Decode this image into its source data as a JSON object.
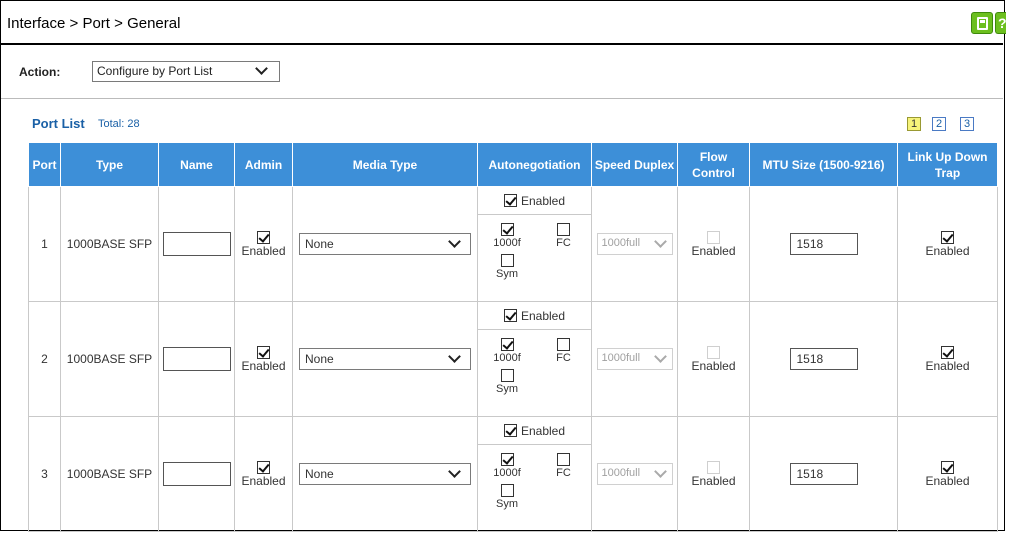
{
  "breadcrumb": "Interface > Port > General",
  "header_icons": [
    "save-icon",
    "help-icon"
  ],
  "action": {
    "label": "Action:",
    "selected": "Configure by Port List"
  },
  "port_list": {
    "title": "Port List",
    "total": "Total: 28",
    "pages": [
      "1",
      "2",
      "3"
    ],
    "active_page": "1"
  },
  "columns": {
    "port": "Port",
    "type": "Type",
    "name": "Name",
    "admin": "Admin",
    "media_type": "Media Type",
    "autonegotiation": "Autonegotiation",
    "speed_duplex": "Speed Duplex",
    "flow_control": "Flow Control",
    "mtu_size": "MTU Size (1500-9216)",
    "link_trap": "Link Up Down Trap"
  },
  "labels": {
    "enabled": "Enabled",
    "cap_1000f": "1000f",
    "cap_fc": "FC",
    "cap_sym": "Sym"
  },
  "rows": [
    {
      "port": "1",
      "type": "1000BASE SFP",
      "name": "",
      "media": "None",
      "speed": "1000full",
      "mtu": "1518"
    },
    {
      "port": "2",
      "type": "1000BASE SFP",
      "name": "",
      "media": "None",
      "speed": "1000full",
      "mtu": "1518"
    },
    {
      "port": "3",
      "type": "1000BASE SFP",
      "name": "",
      "media": "None",
      "speed": "1000full",
      "mtu": "1518"
    }
  ],
  "colors": {
    "header_blue": "#3d8fd8",
    "link_blue": "#1a60a6",
    "page_active": "#f6f37a",
    "icon_green": "#6cbf1e"
  }
}
